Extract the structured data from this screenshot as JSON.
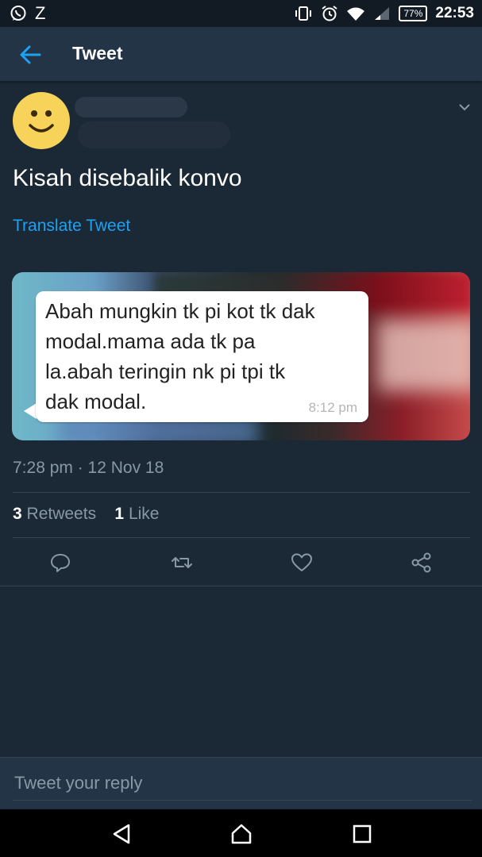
{
  "status_bar": {
    "left_icons": [
      "whatsapp-icon",
      "z-icon"
    ],
    "z_text": "Z",
    "right_icons": [
      "vibrate-icon",
      "alarm-icon",
      "wifi-icon",
      "signal-icon",
      "battery-icon"
    ],
    "battery": "77%",
    "time": "22:53"
  },
  "app_bar": {
    "back_icon": "back-arrow-icon",
    "title": "Tweet"
  },
  "tweet": {
    "text": "Kisah disebalik konvo",
    "translate_label": "Translate Tweet",
    "media": {
      "bubble_lines": [
        "Abah mungkin tk pi kot tk dak",
        "modal.mama ada tk pa",
        "la.abah teringin nk pi tpi tk",
        "dak modal."
      ],
      "bubble_time": "8:12 pm"
    },
    "timestamp": "7:28 pm · 12 Nov 18",
    "retweets_count": "3",
    "retweets_label": "Retweets",
    "likes_count": "1",
    "likes_label": "Like"
  },
  "actions": [
    "reply-icon",
    "retweet-icon",
    "like-icon",
    "share-icon"
  ],
  "reply": {
    "placeholder": "Tweet your reply"
  },
  "colors": {
    "background": "#1b2836",
    "app_bar": "#243447",
    "accent": "#1da1f2",
    "secondary_text": "#8899a6"
  }
}
